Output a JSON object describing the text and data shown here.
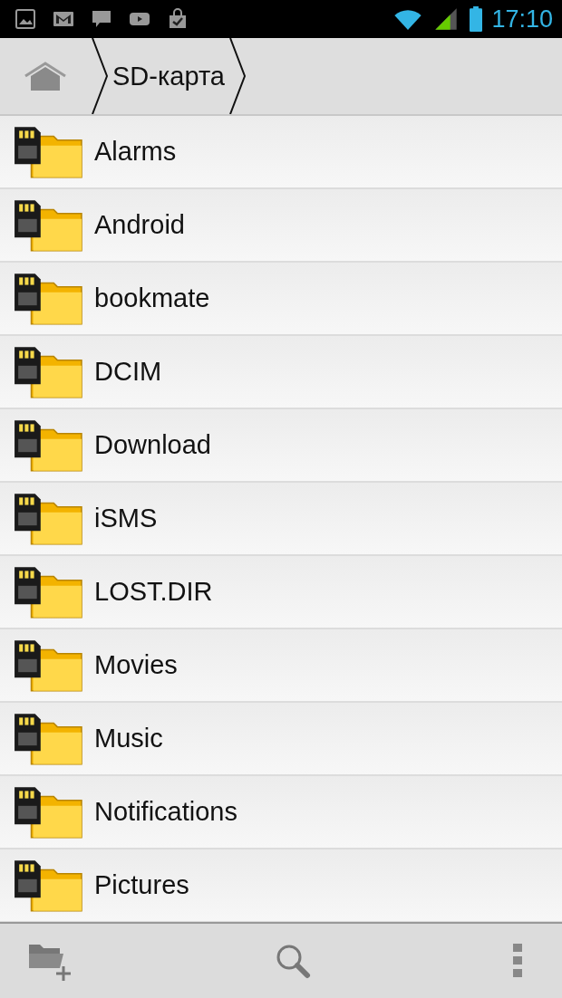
{
  "status_bar": {
    "time": "17:10"
  },
  "breadcrumb": [
    {
      "label": "SD-карта"
    }
  ],
  "folders": [
    {
      "name": "Alarms"
    },
    {
      "name": "Android"
    },
    {
      "name": "bookmate"
    },
    {
      "name": "DCIM"
    },
    {
      "name": "Download"
    },
    {
      "name": "iSMS"
    },
    {
      "name": "LOST.DIR"
    },
    {
      "name": "Movies"
    },
    {
      "name": "Music"
    },
    {
      "name": "Notifications"
    },
    {
      "name": "Pictures"
    }
  ]
}
